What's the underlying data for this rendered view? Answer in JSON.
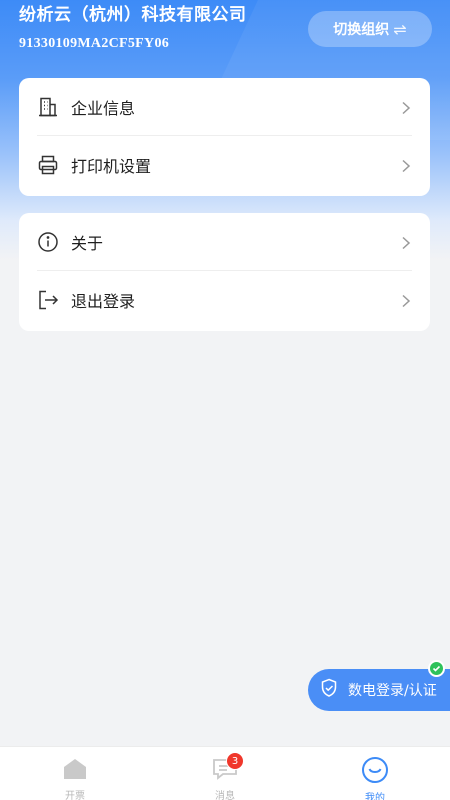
{
  "header": {
    "company_name": "纷析云（杭州）科技有限公司",
    "tax_id": "91330109MA2CF5FY06",
    "switch_org_label": "切换组织",
    "switch_org_icon": "swap-arrows-icon"
  },
  "menu_group_1": [
    {
      "label": "企业信息",
      "icon": "building-icon"
    },
    {
      "label": "打印机设置",
      "icon": "printer-icon"
    }
  ],
  "menu_group_2": [
    {
      "label": "关于",
      "icon": "info-icon"
    },
    {
      "label": "退出登录",
      "icon": "logout-icon"
    }
  ],
  "floating_button": {
    "label": "数电登录/认证",
    "icon": "shield-check-icon",
    "status": "verified"
  },
  "tabbar": {
    "tabs": [
      {
        "label": "开票",
        "icon": "home-icon",
        "active": false
      },
      {
        "label": "消息",
        "icon": "message-icon",
        "badge": "3",
        "active": false
      },
      {
        "label": "我的",
        "icon": "smile-icon",
        "active": true
      }
    ]
  },
  "colors": {
    "primary": "#3d8bf7",
    "badge": "#f0372b",
    "success": "#2fc25b"
  }
}
